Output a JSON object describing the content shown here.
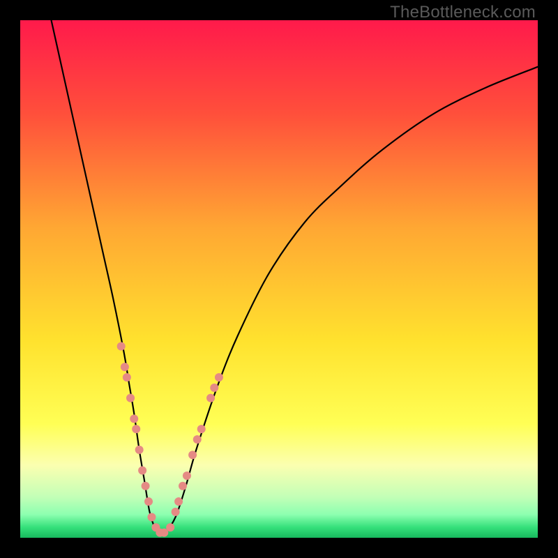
{
  "watermark": "TheBottleneck.com",
  "chart_data": {
    "type": "line",
    "title": "",
    "xlabel": "",
    "ylabel": "",
    "xlim": [
      0,
      100
    ],
    "ylim": [
      0,
      100
    ],
    "grid": false,
    "legend": false,
    "background_gradient": {
      "stops": [
        {
          "offset": 0.0,
          "color": "#ff1a4b"
        },
        {
          "offset": 0.18,
          "color": "#ff4f3b"
        },
        {
          "offset": 0.4,
          "color": "#ffa733"
        },
        {
          "offset": 0.62,
          "color": "#ffe22e"
        },
        {
          "offset": 0.78,
          "color": "#ffff55"
        },
        {
          "offset": 0.86,
          "color": "#fbffb0"
        },
        {
          "offset": 0.92,
          "color": "#c4ffb7"
        },
        {
          "offset": 0.955,
          "color": "#8dffb0"
        },
        {
          "offset": 0.98,
          "color": "#34e07a"
        },
        {
          "offset": 1.0,
          "color": "#18b85e"
        }
      ]
    },
    "series": [
      {
        "name": "bottleneck-curve",
        "color": "#000000",
        "x": [
          6,
          8,
          10,
          12,
          14,
          16,
          18,
          20,
          21,
          22,
          23,
          24,
          25,
          26,
          27,
          28,
          30,
          32,
          34,
          38,
          42,
          48,
          55,
          62,
          70,
          80,
          90,
          100
        ],
        "y": [
          100,
          91,
          82,
          73,
          64,
          55,
          46,
          36,
          30,
          24,
          17,
          11,
          5,
          2,
          1,
          1,
          4,
          10,
          17,
          29,
          39,
          51,
          61,
          68,
          75,
          82,
          87,
          91
        ]
      }
    ],
    "markers": {
      "name": "highlight-points",
      "color": "#e58a84",
      "radius_px": 6,
      "points": [
        {
          "x": 19.5,
          "y": 37
        },
        {
          "x": 20.2,
          "y": 33
        },
        {
          "x": 20.6,
          "y": 31
        },
        {
          "x": 21.3,
          "y": 27
        },
        {
          "x": 22.0,
          "y": 23
        },
        {
          "x": 22.4,
          "y": 21
        },
        {
          "x": 23.0,
          "y": 17
        },
        {
          "x": 23.6,
          "y": 13
        },
        {
          "x": 24.2,
          "y": 10
        },
        {
          "x": 24.8,
          "y": 7
        },
        {
          "x": 25.4,
          "y": 4
        },
        {
          "x": 26.2,
          "y": 2
        },
        {
          "x": 27.0,
          "y": 1
        },
        {
          "x": 27.8,
          "y": 1
        },
        {
          "x": 29.0,
          "y": 2
        },
        {
          "x": 30.0,
          "y": 5
        },
        {
          "x": 30.6,
          "y": 7
        },
        {
          "x": 31.4,
          "y": 10
        },
        {
          "x": 32.2,
          "y": 12
        },
        {
          "x": 33.3,
          "y": 16
        },
        {
          "x": 34.2,
          "y": 19
        },
        {
          "x": 35.0,
          "y": 21
        },
        {
          "x": 36.8,
          "y": 27
        },
        {
          "x": 37.5,
          "y": 29
        },
        {
          "x": 38.4,
          "y": 31
        }
      ]
    }
  }
}
